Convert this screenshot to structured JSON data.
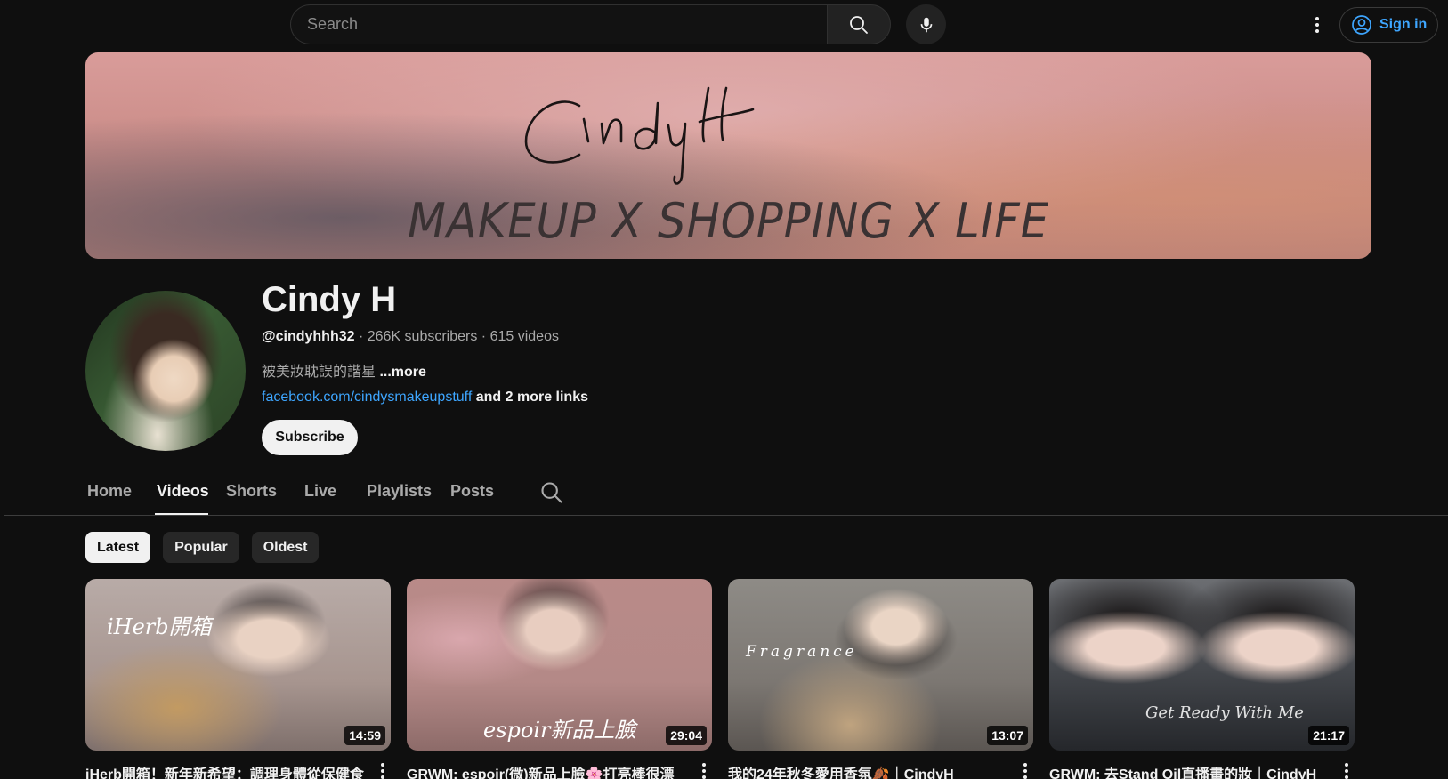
{
  "search": {
    "placeholder": "Search"
  },
  "header": {
    "sign_in_label": "Sign in"
  },
  "banner": {
    "signature": "CindyH",
    "tagline": "MAKEUP X SHOPPING X LIFE"
  },
  "channel": {
    "name": "Cindy H",
    "handle": "@cindyhhh32",
    "subscribers": "266K subscribers",
    "videos_count": "615 videos",
    "separator": " · ",
    "description": "被美妝耽誤的諧星",
    "more_label": "...more",
    "link": "facebook.com/cindysmakeupstuff",
    "more_links": "and 2 more links",
    "subscribe_label": "Subscribe"
  },
  "tabs": [
    {
      "label": "Home"
    },
    {
      "label": "Videos",
      "active": true
    },
    {
      "label": "Shorts"
    },
    {
      "label": "Live"
    },
    {
      "label": "Playlists"
    },
    {
      "label": "Posts"
    }
  ],
  "chips": [
    {
      "label": "Latest",
      "active": true
    },
    {
      "label": "Popular"
    },
    {
      "label": "Oldest"
    }
  ],
  "videos": [
    {
      "title": "iHerb開箱！新年新希望：調理身體從保健食",
      "duration": "14:59",
      "overlay": "iHerb開箱"
    },
    {
      "title": "GRWM: espoir(微)新品上臉🌸打亮棒很漂",
      "duration": "29:04",
      "overlay": "espoir新品上臉"
    },
    {
      "title": "我的24年秋冬愛用香氛🍂｜CindyH",
      "duration": "13:07",
      "overlay": "Fragrance"
    },
    {
      "title": "GRWM: 去Stand Oil直播畫的妝｜CindyH",
      "duration": "21:17",
      "overlay": "Get Ready With Me"
    }
  ],
  "colors": {
    "accent_link": "#3ea6ff",
    "background": "#0f0f0f",
    "text": "#f1f1f1",
    "muted": "#aaaaaa"
  }
}
